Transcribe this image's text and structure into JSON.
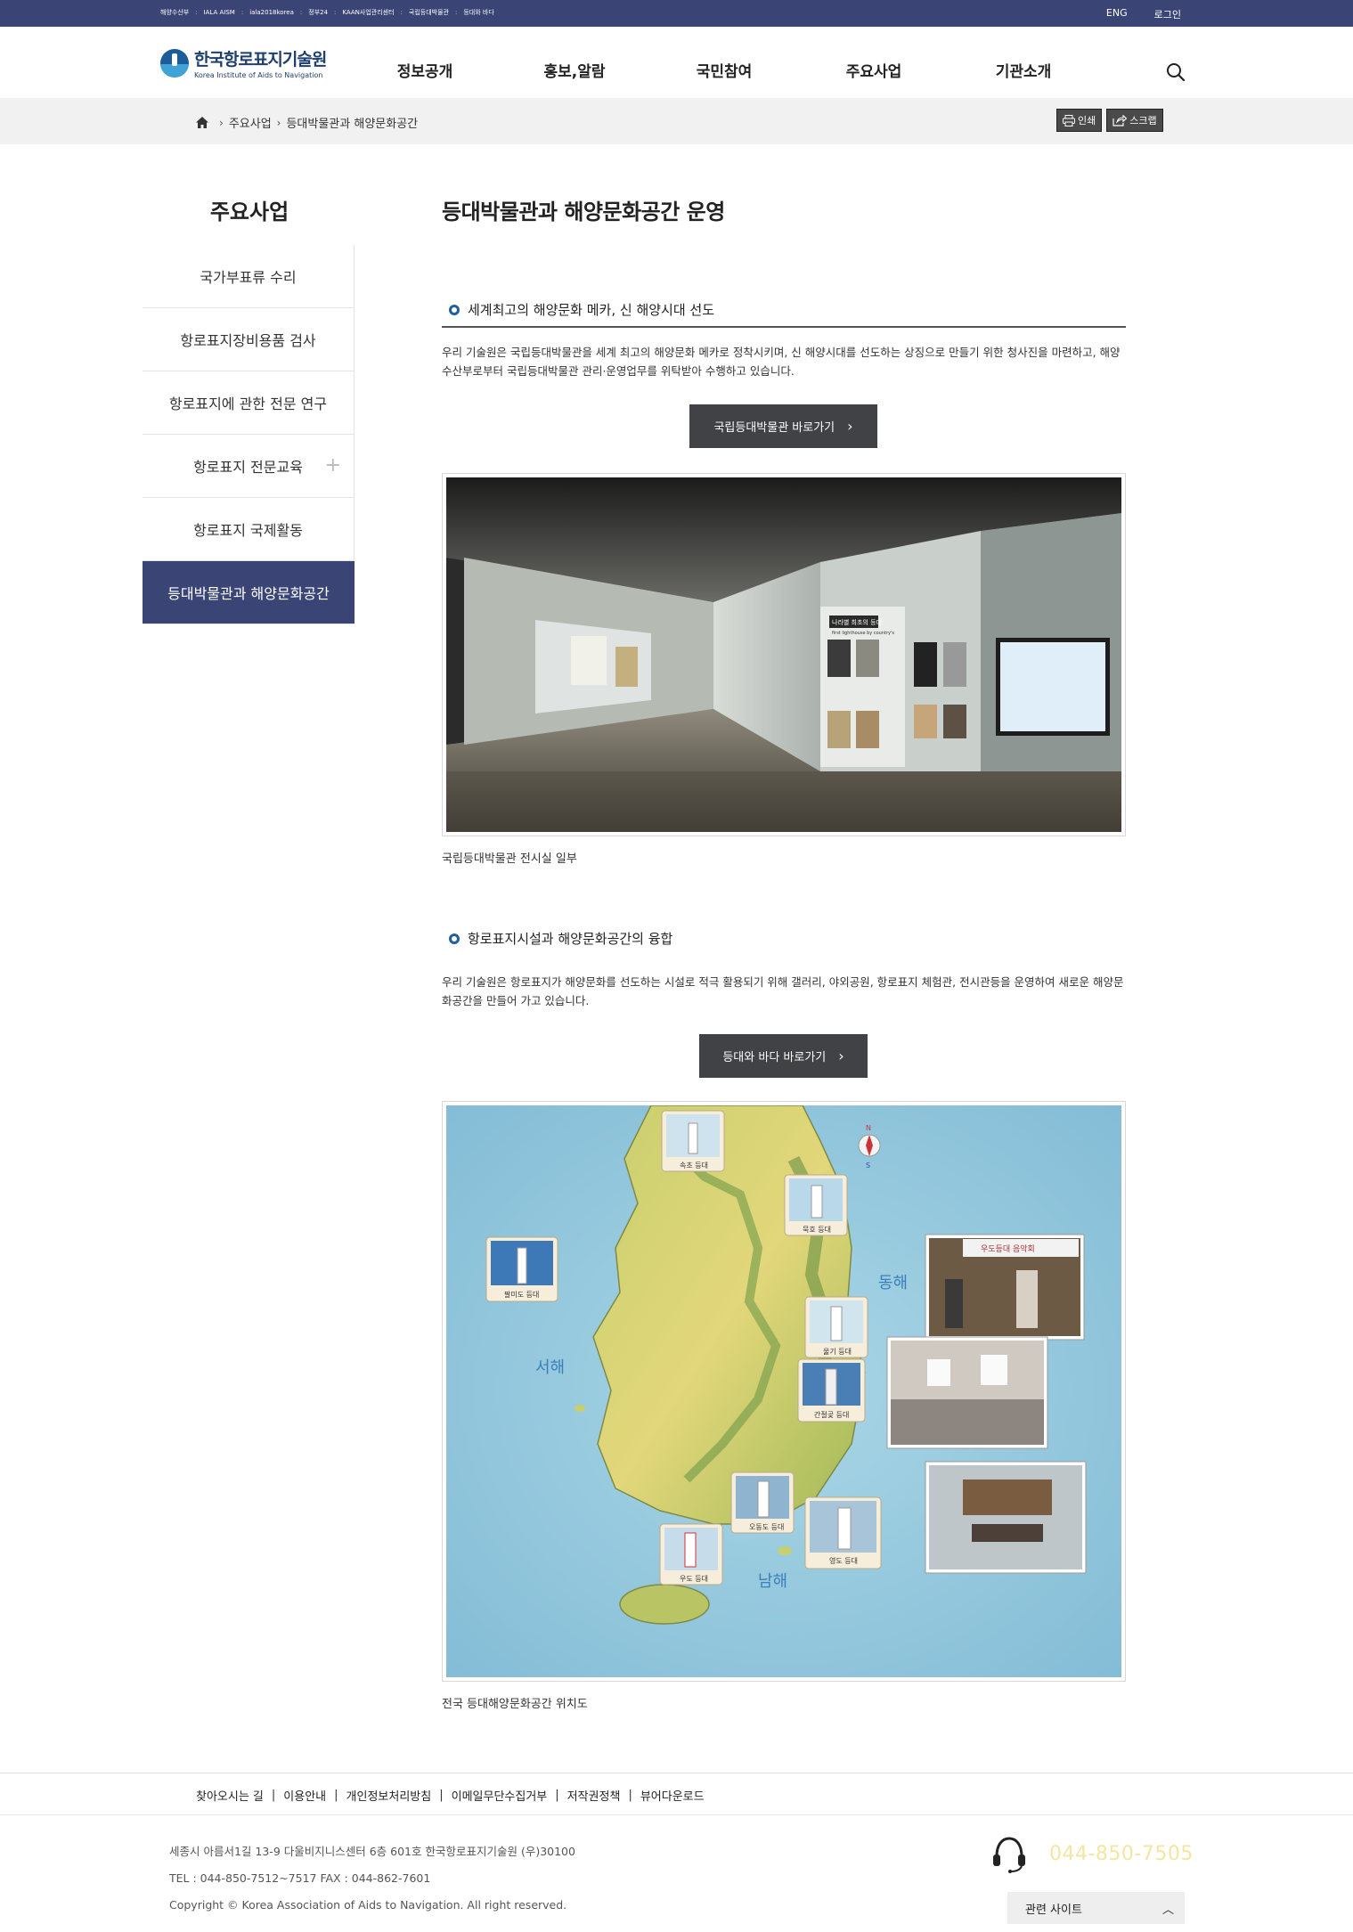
{
  "topbar": {
    "links": [
      "해양수산부",
      "IALA AISM",
      "iala2018korea",
      "정부24",
      "KAAN사업관리센터",
      "국립등대박물관",
      "등대와 바다"
    ],
    "eng": "ENG",
    "login": "로그인"
  },
  "header": {
    "logo_ko": "한국항로표지기술원",
    "logo_en": "Korea Institute of Aids to Navigation",
    "menu": [
      "정보공개",
      "홍보,알람",
      "국민참여",
      "주요사업",
      "기관소개"
    ]
  },
  "breadcrumb": {
    "items": [
      "주요사업",
      "등대박물관과 해양문화공간"
    ],
    "print": "인쇄",
    "scrap": "스크랩"
  },
  "sidebar": {
    "title": "주요사업",
    "items": [
      {
        "label": "국가부표류 수리"
      },
      {
        "label": "항로표지장비용품 검사"
      },
      {
        "label": "항로표지에 관한 전문 연구"
      },
      {
        "label": "항로표지 전문교육"
      },
      {
        "label": "항로표지 국제활동"
      },
      {
        "label": "등대박물관과 해양문화공간"
      }
    ],
    "active_index": 5
  },
  "content": {
    "title": "등대박물관과 해양문화공간 운영",
    "section1": {
      "heading": "세계최고의 해양문화 메카, 신 해양시대 선도",
      "text": "우리 기술원은 국립등대박물관을 세계 최고의 해양문화 메카로 정착시키며, 신 해양시대를 선도하는 상징으로 만들기 위한 청사진을 마련하고, 해양수산부로부터 국립등대박물관 관리·운영업무를 위탁받아 수행하고 있습니다.",
      "button": "국립등대박물관 바로가기",
      "image_caption": "국립등대박물관 전시실 일부",
      "panel_title": "나라별 최초의 등대",
      "panel_sub": "first lighthouse by country's"
    },
    "section2": {
      "heading": "항로표지시설과 해양문화공간의 융합",
      "text": "우리 기술원은 항로표지가 해양문화를 선도하는 시설로 적극 활용되기 위해 갤러리, 야외공원, 항로표지 체험관, 전시관등을 운영하여 새로운 해양문화공간을 만들어 가고 있습니다.",
      "button": "등대와 바다 바로가기",
      "image_caption": "전국 등대해양문화공간 위치도",
      "map": {
        "east_sea": "동해",
        "west_sea": "서해",
        "south_sea": "남해",
        "compass_n": "N",
        "compass_s": "S",
        "banner": "우도등대 음악회",
        "lighthouses": [
          "속초 등대",
          "묵호 등대",
          "팔미도 등대",
          "울기 등대",
          "간절곶 등대",
          "오동도 등대",
          "영도 등대",
          "우도 등대"
        ]
      }
    }
  },
  "footer": {
    "links": [
      "찾아오시는 길",
      "이용안내",
      "개인정보처리방침",
      "이메일무단수집거부",
      "저작권정책",
      "뷰어다운로드"
    ],
    "address": "세종시 아름서1길 13-9 다울비지니스센터 6층 601호 한국항로표지기술원 (우)30100",
    "tel": "TEL : 044-850-7512~7517 FAX : 044-862-7601",
    "copyright": "Copyright © Korea Association of Aids to Navigation. All right reserved.",
    "phone": "044-850-7505",
    "related": "관련 사이트"
  }
}
